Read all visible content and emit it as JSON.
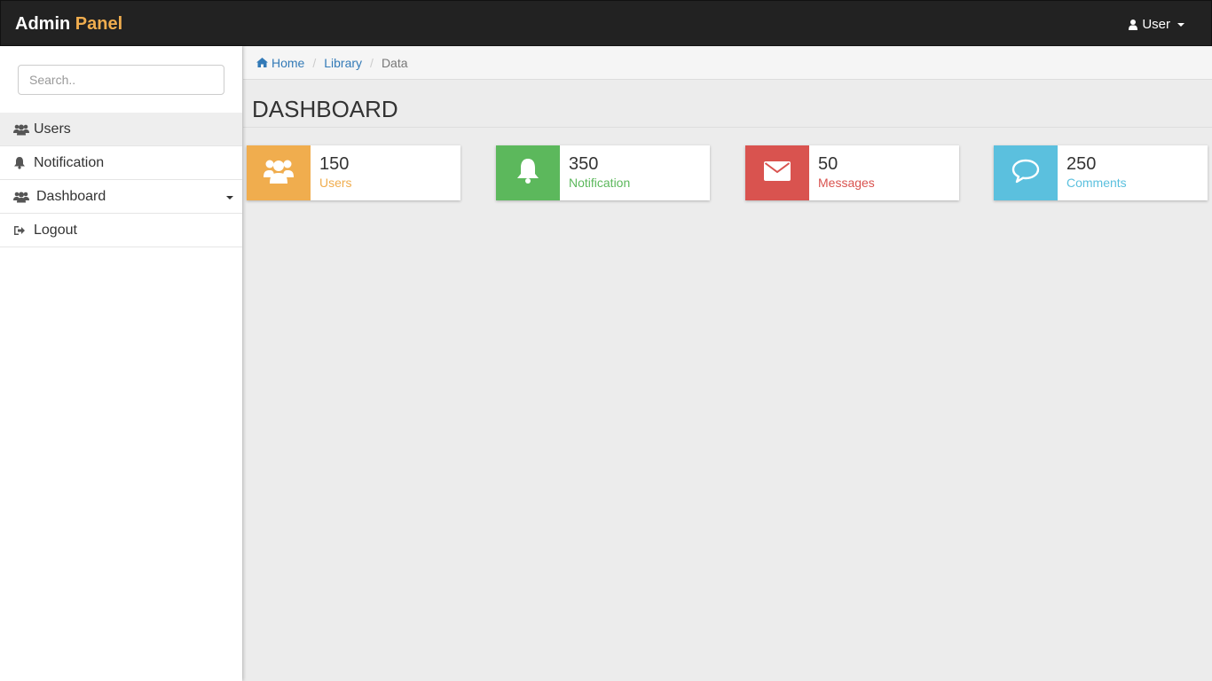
{
  "navbar": {
    "brand_main": "Admin",
    "brand_accent": "Panel",
    "user_label": "User",
    "user_icon": "user-icon",
    "brand_accent_color": "#f0ad4e"
  },
  "sidebar": {
    "search_placeholder": "Search..",
    "items": [
      {
        "label": "Users",
        "icon": "users-icon",
        "active": true
      },
      {
        "label": "Notification",
        "icon": "bell-icon",
        "active": false
      },
      {
        "label": "Dashboard",
        "icon": "users-icon",
        "active": false,
        "has_dropdown": true
      },
      {
        "label": "Logout",
        "icon": "sign-out-icon",
        "active": false
      }
    ]
  },
  "breadcrumb": {
    "items": [
      {
        "label": "Home",
        "icon": "home-icon"
      },
      {
        "label": "Library"
      },
      {
        "label": "Data"
      }
    ],
    "separator": "/"
  },
  "main": {
    "title": "DASHBOARD",
    "cards": [
      {
        "value": "150",
        "label": "Users",
        "icon": "users-icon",
        "color": "#f0ad4e"
      },
      {
        "value": "350",
        "label": "Notification",
        "icon": "bell-icon",
        "color": "#5cb85c"
      },
      {
        "value": "50",
        "label": "Messages",
        "icon": "envelope-icon",
        "color": "#d9534f"
      },
      {
        "value": "250",
        "label": "Comments",
        "icon": "comment-icon",
        "color": "#5bc0de"
      }
    ]
  }
}
